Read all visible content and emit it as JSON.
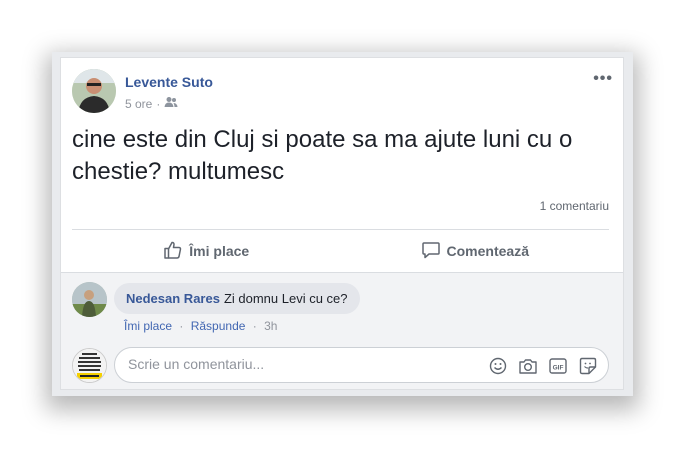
{
  "post": {
    "author": "Levente Suto",
    "time": "5 ore",
    "separator": "·",
    "audience_icon": "friends-icon",
    "text": "cine este din Cluj si poate sa ma ajute luni cu o chestie? multumesc",
    "comment_count": "1 comentariu"
  },
  "actions": {
    "like_label": "Îmi place",
    "comment_label": "Comentează"
  },
  "comment": {
    "author": "Nedesan Rares",
    "text": "Zi domnu Levi cu ce?",
    "like_link": "Îmi place",
    "reply_link": "Răspunde",
    "separator": "·",
    "time": "3h"
  },
  "composer": {
    "placeholder": "Scrie un comentariu...",
    "tool_icons": [
      "emoji-icon",
      "camera-icon",
      "gif-icon",
      "sticker-icon"
    ]
  },
  "colors": {
    "link_blue": "#385898",
    "text": "#1d2129",
    "muted": "#90949c"
  }
}
